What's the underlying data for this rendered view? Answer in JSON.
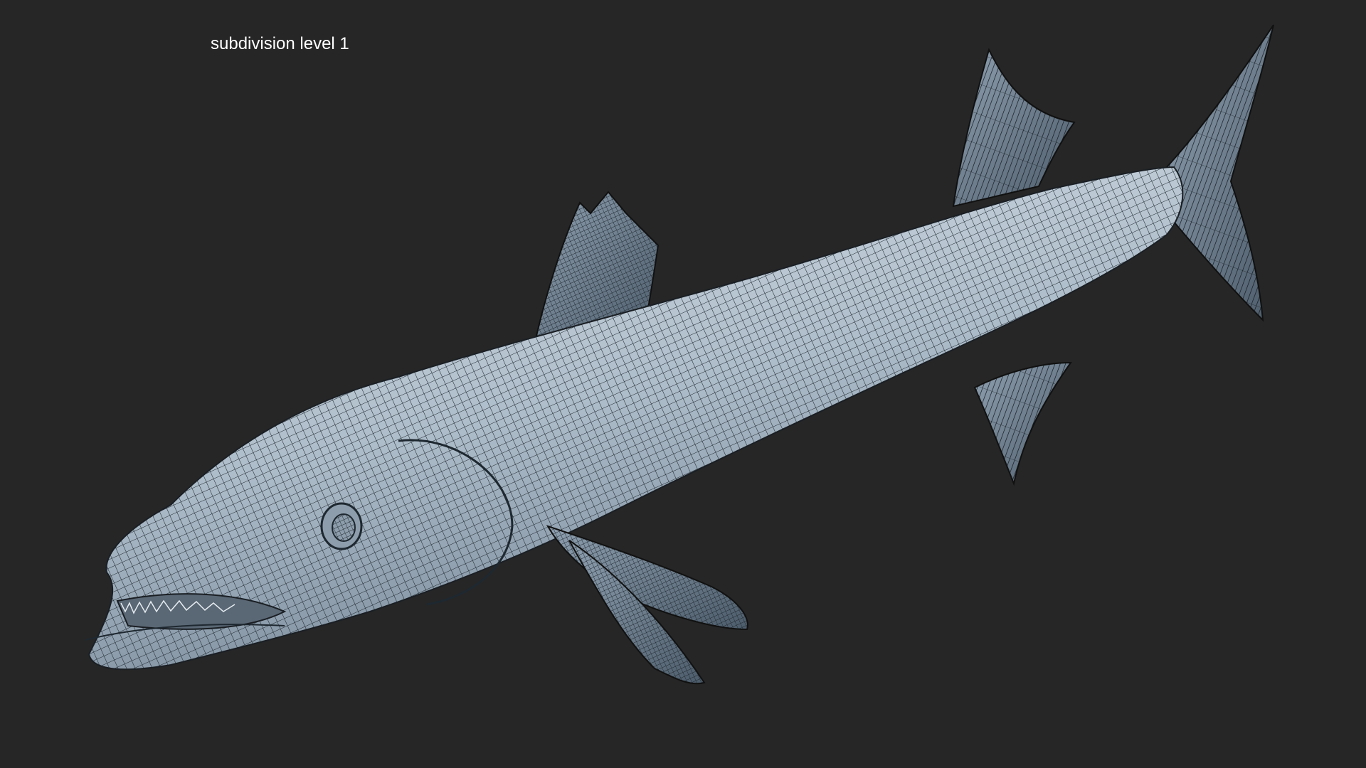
{
  "viewport": {
    "label": "subdivision level 1",
    "background_color": "#262626",
    "label_color": "#ffffff"
  },
  "model": {
    "subject": "barracuda-wireframe-render",
    "body_color": "#b6c4d0",
    "wire_color": "#1e2830",
    "shadow_color": "#6f8090"
  }
}
